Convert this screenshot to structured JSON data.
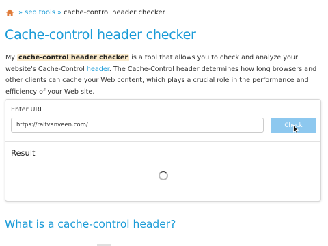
{
  "breadcrumb": {
    "home_icon": "home-icon",
    "separator": "»",
    "parent": "seo tools",
    "current": "cache-control header checker"
  },
  "page_title": "Cache-control header checker",
  "intro": {
    "prefix": "My ",
    "highlight": "cache-control header checker",
    "middle": " is a tool that allows you to check and analyze your website's Cache-Control ",
    "link": "header",
    "suffix": ". The Cache-Control header determines how long browsers and other clients can cache your Web content, which plays a crucial role in the performance and efficiency of your Web site."
  },
  "form": {
    "url_label": "Enter URL",
    "url_value": "https://ralfvanveen.com/",
    "check_label": "Check"
  },
  "result": {
    "heading": "Result",
    "spinner_icon": "spinner-icon"
  },
  "section_heading": "What is a cache-control header?",
  "colors": {
    "accent": "#1a9bd7",
    "highlight_bg": "#fbebcc",
    "button_bg": "#8dc8ef"
  }
}
